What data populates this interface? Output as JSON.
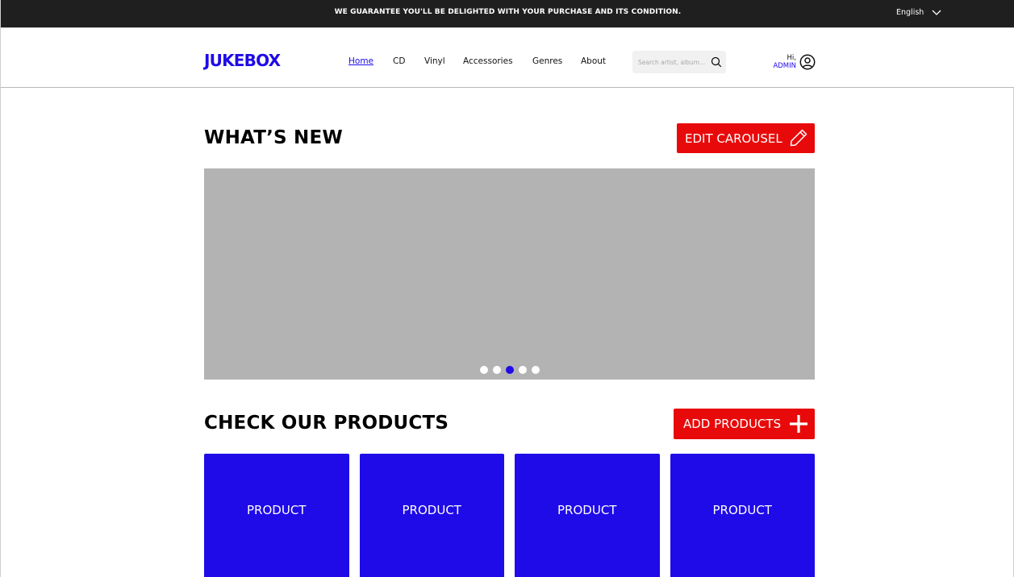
{
  "topbar": {
    "promo": "WE GUARANTEE YOU'LL BE DELIGHTED WITH YOUR PURCHASE AND ITS CONDITION.",
    "language": "English"
  },
  "header": {
    "logo": "JUKEBOX",
    "nav": [
      {
        "label": "Home",
        "active": true
      },
      {
        "label": "CD",
        "active": false
      },
      {
        "label": "Vinyl",
        "active": false
      },
      {
        "label": "Accessories",
        "active": false
      },
      {
        "label": "Genres",
        "active": false
      },
      {
        "label": "About",
        "active": false
      }
    ],
    "search": {
      "placeholder": "Search artist, album...",
      "value": ""
    },
    "user": {
      "greeting": "Hi,",
      "name": "ADMIN"
    }
  },
  "whats_new": {
    "title": "WHAT’S NEW",
    "edit_button": "EDIT CAROUSEL",
    "carousel": {
      "slides": 5,
      "active_slide": 3
    }
  },
  "products_section": {
    "title": "CHECK OUR PRODUCTS",
    "add_button": "ADD PRODUCTS",
    "items": [
      "PRODUCT",
      "PRODUCT",
      "PRODUCT",
      "PRODUCT"
    ]
  },
  "colors": {
    "accent": "#1f0ae8",
    "action": "#e80a0a",
    "topbar": "#1f1f1f",
    "placeholder": "#b3b3b3"
  },
  "icons": [
    "chevron-down-icon",
    "search-icon",
    "user-icon",
    "pencil-icon",
    "plus-icon"
  ]
}
